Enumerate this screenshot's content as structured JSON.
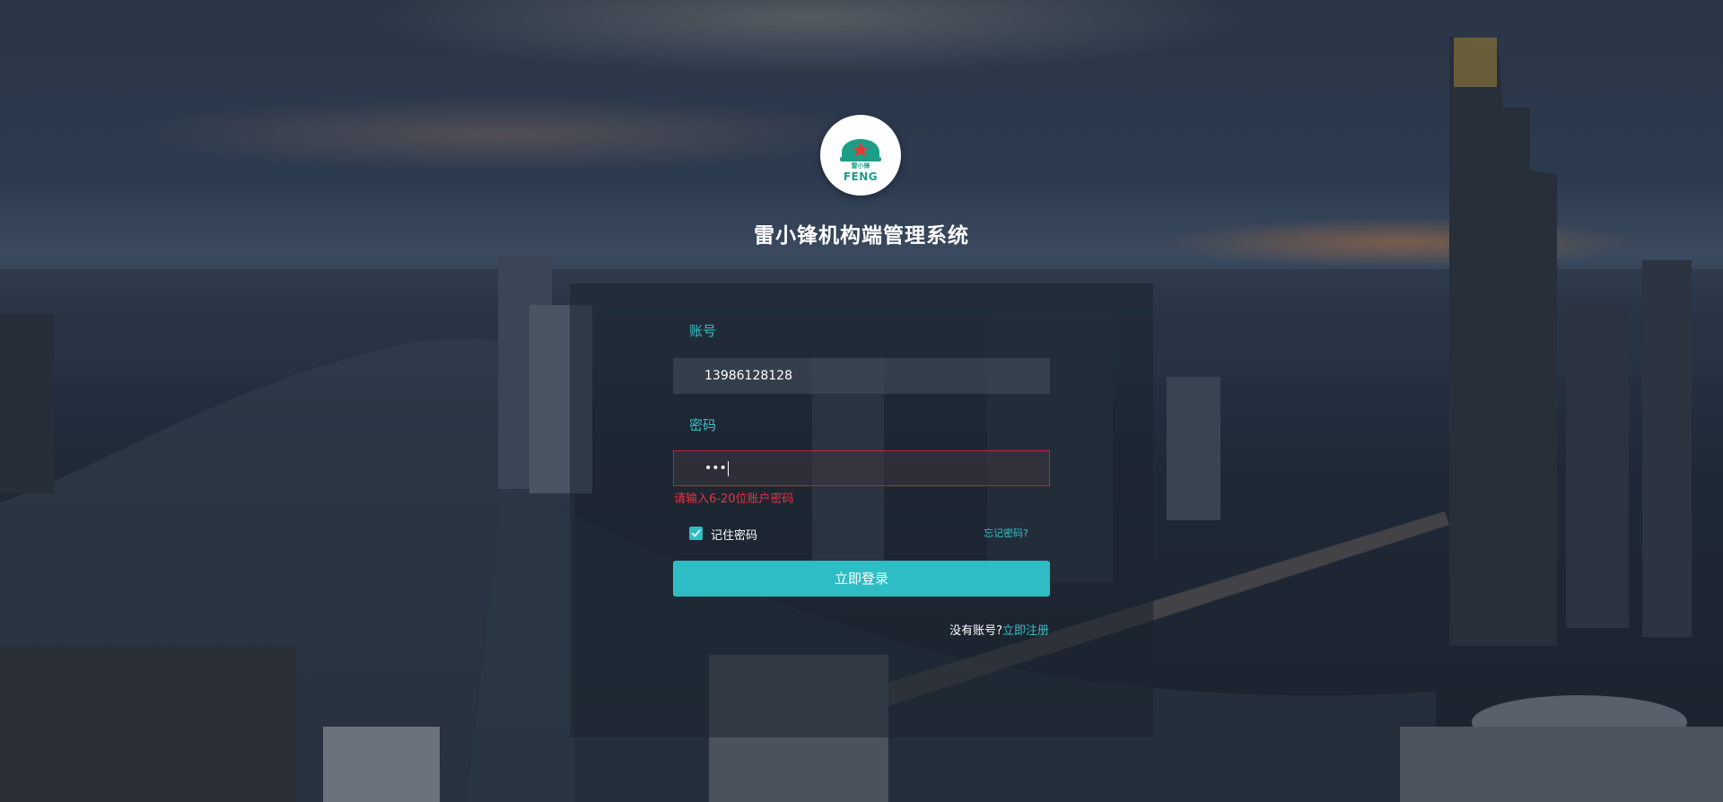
{
  "app": {
    "logo_text": "FENG",
    "logo_subtext": "雷小锋",
    "title": "雷小锋机构端管理系统"
  },
  "form": {
    "account_label": "账号",
    "account_value": "13986128128",
    "password_label": "密码",
    "password_value": "•••",
    "password_error": "请输入6-20位账户密码",
    "remember_label": "记住密码",
    "remember_checked": true,
    "forgot_link": "忘记密码?",
    "login_button": "立即登录",
    "no_account_text": "没有账号?",
    "register_link": "立即注册"
  },
  "colors": {
    "accent": "#2ebdc4",
    "error": "#e8343f",
    "logo_green": "#1e9e87"
  }
}
